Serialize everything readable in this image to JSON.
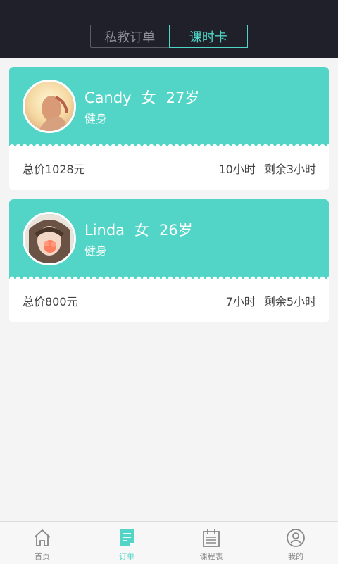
{
  "header": {
    "tabs": [
      {
        "label": "私教订单",
        "active": false
      },
      {
        "label": "课时卡",
        "active": true
      }
    ]
  },
  "cards": [
    {
      "name": "Candy",
      "gender": "女",
      "age": "27岁",
      "goal": "健身",
      "total": "总价1028元",
      "hours": "10小时",
      "remaining": "剩余3小时"
    },
    {
      "name": "Linda",
      "gender": "女",
      "age": "26岁",
      "goal": "健身",
      "total": "总价800元",
      "hours": "7小时",
      "remaining": "剩余5小时"
    }
  ],
  "tabbar": [
    {
      "label": "首页",
      "icon": "home-icon"
    },
    {
      "label": "订单",
      "icon": "order-icon",
      "active": true
    },
    {
      "label": "课程表",
      "icon": "calendar-icon"
    },
    {
      "label": "我的",
      "icon": "profile-icon"
    }
  ],
  "colors": {
    "accent": "#52d5c6",
    "header_bg": "#20202b"
  }
}
